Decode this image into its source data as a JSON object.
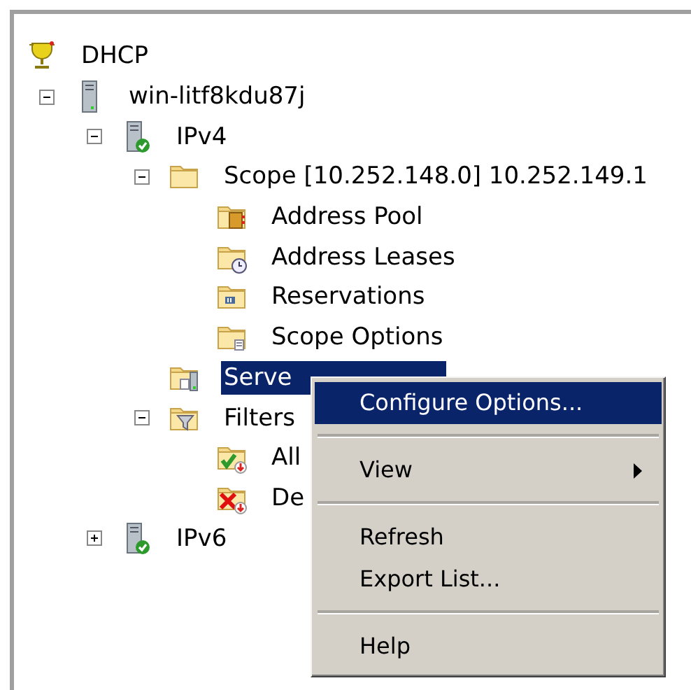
{
  "tree": [
    {
      "label": "DHCP",
      "kind": "dhcp",
      "selected": false,
      "children": [
        {
          "label": "win-litf8kdu87j",
          "kind": "server",
          "expanded": true,
          "selected": false,
          "children": [
            {
              "label": "IPv4",
              "kind": "server-ok",
              "expanded": true,
              "selected": false,
              "children": [
                {
                  "label": "Scope [10.252.148.0] 10.252.149.1",
                  "kind": "folder",
                  "expanded": true,
                  "selected": false,
                  "children": [
                    {
                      "label": "Address Pool",
                      "kind": "pool",
                      "selected": false
                    },
                    {
                      "label": "Address Leases",
                      "kind": "leases",
                      "selected": false
                    },
                    {
                      "label": "Reservations",
                      "kind": "reservations",
                      "selected": false
                    },
                    {
                      "label": "Scope Options",
                      "kind": "options",
                      "selected": false
                    }
                  ]
                },
                {
                  "label": "Serve",
                  "kind": "server-options",
                  "selected": true
                },
                {
                  "label": "Filters",
                  "kind": "filters",
                  "expanded": true,
                  "selected": false,
                  "children": [
                    {
                      "label": "All",
                      "kind": "allow",
                      "selected": false
                    },
                    {
                      "label": "De",
                      "kind": "deny",
                      "selected": false
                    }
                  ]
                }
              ]
            },
            {
              "label": "IPv6",
              "kind": "server-ok",
              "expanded": false,
              "selected": false
            }
          ]
        }
      ]
    }
  ],
  "context_menu": [
    {
      "kind": "item",
      "label": "Configure Options...",
      "selected": true,
      "submenu": false
    },
    {
      "kind": "separator"
    },
    {
      "kind": "item",
      "label": "View",
      "selected": false,
      "submenu": true
    },
    {
      "kind": "separator"
    },
    {
      "kind": "item",
      "label": "Refresh",
      "selected": false,
      "submenu": false
    },
    {
      "kind": "item",
      "label": "Export List...",
      "selected": false,
      "submenu": false
    },
    {
      "kind": "separator"
    },
    {
      "kind": "item",
      "label": "Help",
      "selected": false,
      "submenu": false
    }
  ]
}
